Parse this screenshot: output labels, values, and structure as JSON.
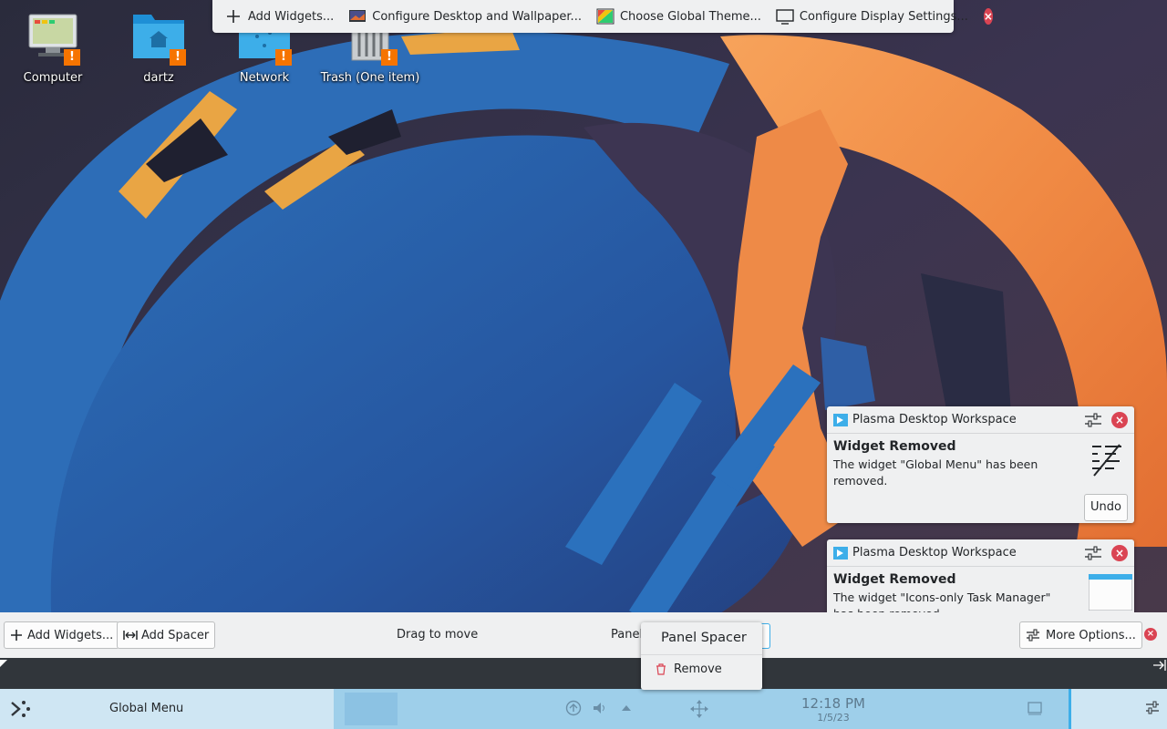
{
  "desktop": {
    "icons": [
      {
        "name": "computer",
        "label": "Computer"
      },
      {
        "name": "home-folder",
        "label": "dartz"
      },
      {
        "name": "network",
        "label": "Network"
      },
      {
        "name": "trash",
        "label": "Trash (One item)"
      }
    ],
    "warning_glyph": "!"
  },
  "toolbox": {
    "add_widgets": "Add Widgets...",
    "configure_desktop": "Configure Desktop and Wallpaper...",
    "choose_theme": "Choose Global Theme...",
    "configure_display": "Configure Display Settings..."
  },
  "notifications": [
    {
      "app": "Plasma Desktop Workspace",
      "title": "Widget Removed",
      "text": "The widget \"Global Menu\" has been removed.",
      "action": "Undo",
      "thumb_icon": "global-menu-icon"
    },
    {
      "app": "Plasma Desktop Workspace",
      "title": "Widget Removed",
      "text": "The widget \"Icons-only Task Manager\" has been removed.",
      "thumb_icon": "window-icon"
    }
  ],
  "panel_edit": {
    "add_widgets": "Add Widgets...",
    "add_spacer": "Add Spacer",
    "drag_hint": "Drag to move",
    "panel_label": "Panel",
    "more_options": "More Options..."
  },
  "popup": {
    "title": "Panel Spacer",
    "remove": "Remove"
  },
  "panel": {
    "global_menu": "Global Menu",
    "time": "12:18 PM",
    "date": "1/5/23"
  },
  "colors": {
    "accent": "#3daee9",
    "close_red": "#da4453",
    "warning_orange": "#f67400",
    "panel_blue": "#9ecfea",
    "toolbar_bg": "#eff0f1"
  }
}
